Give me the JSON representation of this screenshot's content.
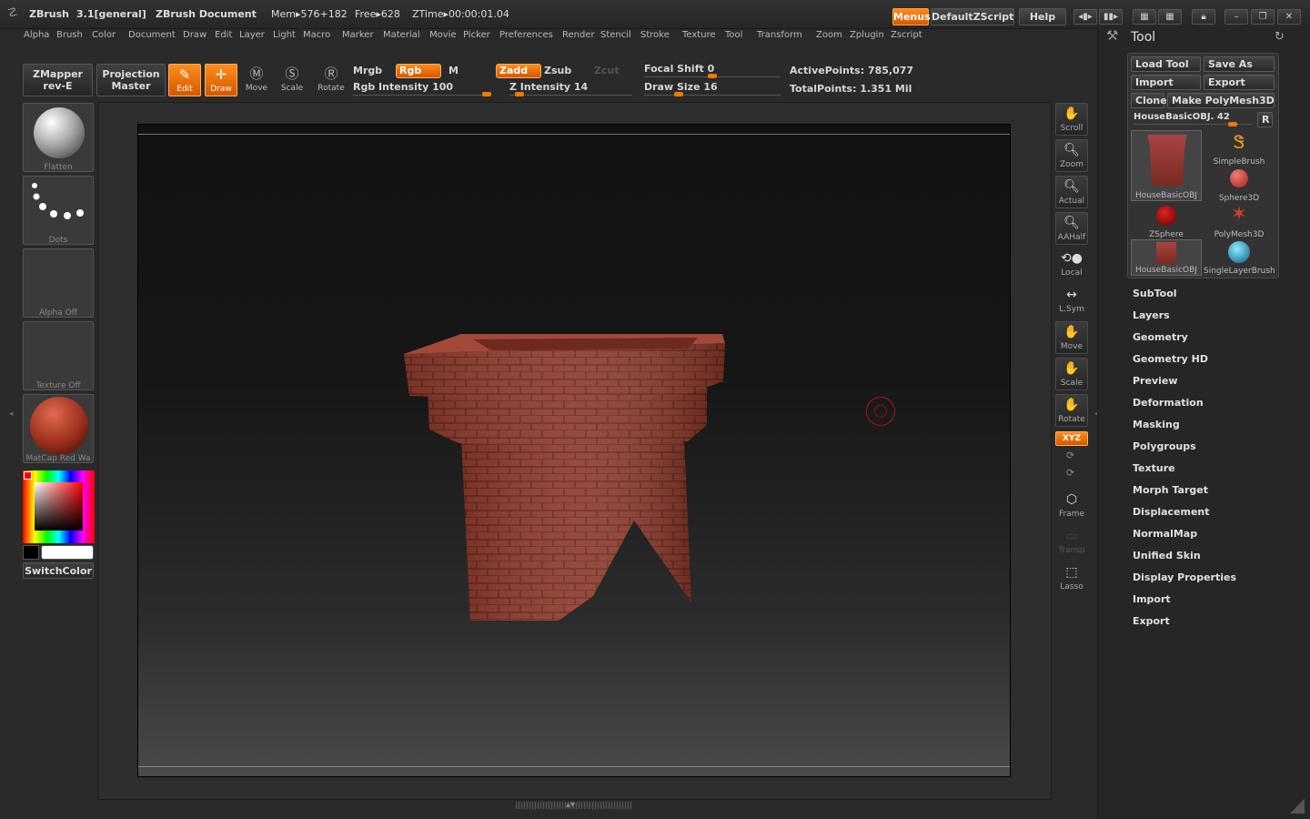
{
  "titlebar": {
    "app": "ZBrush",
    "version": "3.1[general]",
    "document": "ZBrush Document",
    "mem": "Mem▸576+182",
    "free": "Free▸628",
    "ztime": "ZTime▸00:00:01.04",
    "menus_btn": "Menus",
    "script_btn": "DefaultZScript",
    "help_btn": "Help"
  },
  "menubar": [
    "Alpha",
    "Brush",
    "Color",
    "Document",
    "Draw",
    "Edit",
    "Layer",
    "Light",
    "Macro",
    "Marker",
    "Material",
    "Movie",
    "Picker",
    "Preferences",
    "Render",
    "Stencil",
    "Stroke",
    "Texture",
    "Tool",
    "Transform",
    "Zoom",
    "Zplugin",
    "Zscript"
  ],
  "shelf": {
    "zmapper_line1": "ZMapper",
    "zmapper_line2": "rev-E",
    "projection_line1": "Projection",
    "projection_line2": "Master",
    "tools": [
      {
        "label": "Edit",
        "icon": "✎",
        "active": true
      },
      {
        "label": "Draw",
        "icon": "✛",
        "active": true
      },
      {
        "label": "Move",
        "icon": "M",
        "active": false
      },
      {
        "label": "Scale",
        "icon": "S",
        "active": false
      },
      {
        "label": "Rotate",
        "icon": "R",
        "active": false
      }
    ],
    "mrgb": "Mrgb",
    "rgb": "Rgb",
    "m": "M",
    "rgb_intensity": "Rgb Intensity 100",
    "zadd": "Zadd",
    "zsub": "Zsub",
    "zcut": "Zcut",
    "z_intensity": "Z Intensity 14",
    "focal_shift": "Focal Shift 0",
    "draw_size": "Draw Size 16",
    "active_points": "ActivePoints: 785,077",
    "total_points": "TotalPoints: 1.351 Mil"
  },
  "left_tray": {
    "brush": "Flatten",
    "stroke": "Dots",
    "alpha": "Alpha Off",
    "texture": "Texture Off",
    "material": "MatCap Red Wa",
    "switch_color": "SwitchColor"
  },
  "right_tray": [
    "Scroll",
    "Zoom",
    "Actual",
    "AAHalf",
    "Local",
    "L.Sym",
    "Move",
    "Scale",
    "Rotate",
    "XYZ",
    "Frame",
    "Transp",
    "Lasso"
  ],
  "tool_palette": {
    "title": "Tool",
    "load_tool": "Load Tool",
    "save_as": "Save As",
    "import": "Import",
    "export": "Export",
    "clone": "Clone",
    "make_polymesh": "Make PolyMesh3D",
    "current_tool": "HouseBasicOBJ. 42",
    "r_btn": "R",
    "thumbs": [
      "HouseBasicOBJ",
      "SimpleBrush",
      "Sphere3D",
      "ZSphere",
      "PolyMesh3D",
      "HouseBasicOBJ",
      "SingleLayerBrush"
    ],
    "sections": [
      "SubTool",
      "Layers",
      "Geometry",
      "Geometry HD",
      "Preview",
      "Deformation",
      "Masking",
      "Polygroups",
      "Texture",
      "Morph Target",
      "Displacement",
      "NormalMap",
      "Unified Skin",
      "Display Properties",
      "Import",
      "Export"
    ]
  },
  "colors": {
    "accent": "#f07800",
    "brick": "#8e3a2c"
  }
}
